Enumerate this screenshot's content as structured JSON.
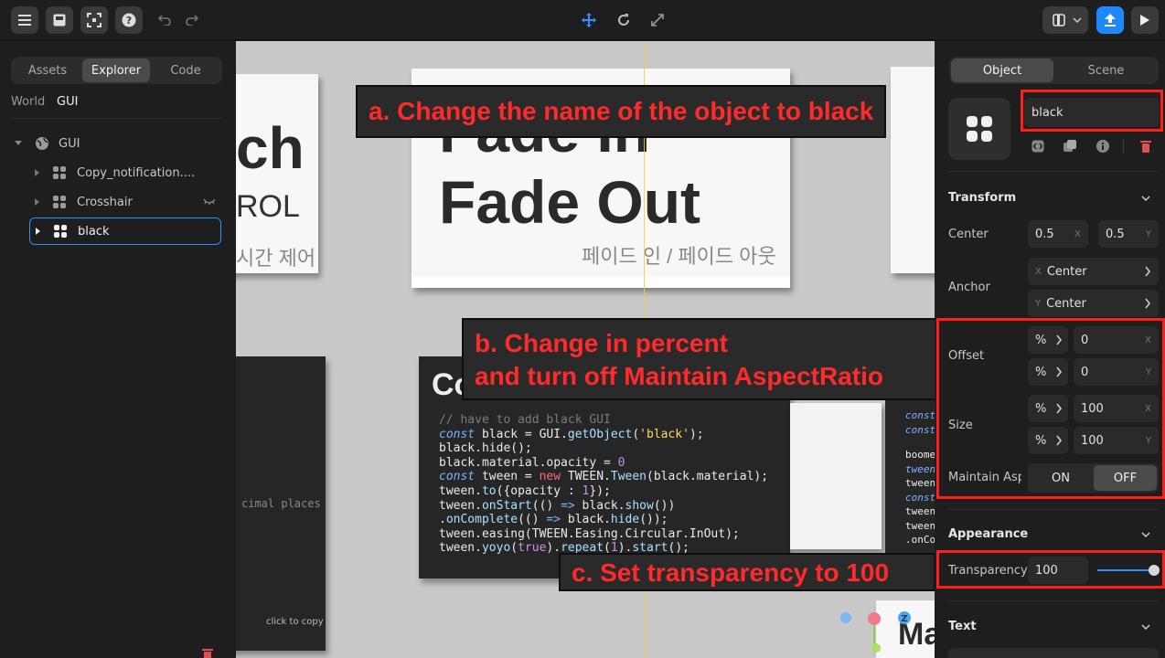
{
  "left_panel": {
    "tabs": [
      "Assets",
      "Explorer",
      "Code"
    ],
    "active_tab": "Explorer",
    "sub_tabs": [
      "World",
      "GUI"
    ],
    "tree": {
      "root": "GUI",
      "items": [
        "Copy_notification....",
        "Crosshair",
        "black"
      ]
    }
  },
  "viewport": {
    "card1": {
      "title": "ch",
      "subtitle": "ROL",
      "korean": "시간 제어"
    },
    "card2": {
      "line1": "Fade In",
      "line2": "Fade Out",
      "korean": "페이드 인 / 페이드 아웃"
    },
    "card3": {
      "title": "Co"
    },
    "left_dark": {
      "text": "cimal places",
      "copy": "click to copy"
    },
    "code_lines": [
      "// have to add black GUI",
      "const black = GUI.getObject('black');",
      "black.hide();",
      "black.material.opacity = 0",
      "const tween = new TWEEN.Tween(black.material);",
      "tween.to({opacity : 1});",
      "tween.onStart(() => black.show())",
      ".onComplete(() => black.hide());",
      "tween.easing(TWEEN.Easing.Circular.InOut);",
      "tween.yoyo(true).repeat(1).start();"
    ],
    "right_code": [
      "const",
      "const",
      "boome",
      "tween",
      "tween",
      "const",
      "tween",
      "tween",
      ".onCom"
    ],
    "bottom_card": "Ma",
    "gizmo_axis": "Z"
  },
  "callouts": {
    "a": "a. Change the name of the object to black",
    "b1": "b. Change in percent",
    "b2": "and turn off Maintain AspectRatio",
    "c": "c. Set transparency to 100"
  },
  "right_panel": {
    "tabs": [
      "Object",
      "Scene"
    ],
    "active_tab": "Object",
    "name_value": "black",
    "transform": {
      "header": "Transform",
      "center_label": "Center",
      "center_x": "0.5",
      "center_y": "0.5",
      "anchor_label": "Anchor",
      "anchor_x": "Center",
      "anchor_y": "Center",
      "offset_label": "Offset",
      "offset_x": "0",
      "offset_y": "0",
      "size_label": "Size",
      "size_x": "100",
      "size_y": "100",
      "unit": "%",
      "axis_x": "X",
      "axis_y": "Y",
      "maintain_label": "Maintain Aspe",
      "on": "ON",
      "off": "OFF"
    },
    "appearance": {
      "header": "Appearance",
      "transparency_label": "Transparency",
      "transparency_value": "100",
      "transparency_fraction": 1.0
    },
    "text_header": "Text"
  },
  "colors": {
    "accent": "#1e88ff",
    "annotation_red": "#ff1e1e",
    "delete_red": "#e05050"
  }
}
